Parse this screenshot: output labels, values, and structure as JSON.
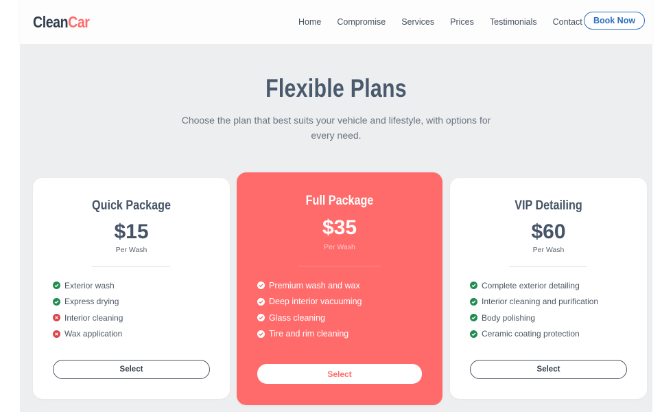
{
  "brand": {
    "part1": "Clean",
    "part2": "Car"
  },
  "nav": [
    {
      "label": "Home"
    },
    {
      "label": "Compromise"
    },
    {
      "label": "Services"
    },
    {
      "label": "Prices"
    },
    {
      "label": "Testimonials"
    },
    {
      "label": "Contact"
    }
  ],
  "cta": {
    "label": "Book Now"
  },
  "section": {
    "title": "Flexible Plans",
    "subtitle": "Choose the plan that best suits your vehicle and lifestyle, with options for every need."
  },
  "plans": [
    {
      "name": "Quick Package",
      "price": "$15",
      "unit": "Per Wash",
      "features": [
        {
          "label": "Exterior wash",
          "included": true
        },
        {
          "label": "Express drying",
          "included": true
        },
        {
          "label": "Interior cleaning",
          "included": false
        },
        {
          "label": "Wax application",
          "included": false
        }
      ],
      "button": "Select"
    },
    {
      "name": "Full Package",
      "price": "$35",
      "unit": "Per Wash",
      "features": [
        {
          "label": "Premium wash and wax",
          "included": true
        },
        {
          "label": "Deep interior vacuuming",
          "included": true
        },
        {
          "label": "Glass cleaning",
          "included": true
        },
        {
          "label": "Tire and rim cleaning",
          "included": true
        }
      ],
      "button": "Select"
    },
    {
      "name": "VIP Detailing",
      "price": "$60",
      "unit": "Per Wash",
      "features": [
        {
          "label": "Complete exterior detailing",
          "included": true
        },
        {
          "label": "Interior cleaning and purification",
          "included": true
        },
        {
          "label": "Body polishing",
          "included": true
        },
        {
          "label": "Ceramic coating protection",
          "included": true
        }
      ],
      "button": "Select"
    }
  ],
  "colors": {
    "accent": "#ff6b6b",
    "brand_dark": "#2f3d4d",
    "link_blue": "#2b6fbf",
    "included": "#1f8c4e",
    "excluded": "#d9464b",
    "section_bg": "#eceeef"
  },
  "icons": {
    "included": "check-circle-icon",
    "excluded": "x-circle-icon"
  }
}
